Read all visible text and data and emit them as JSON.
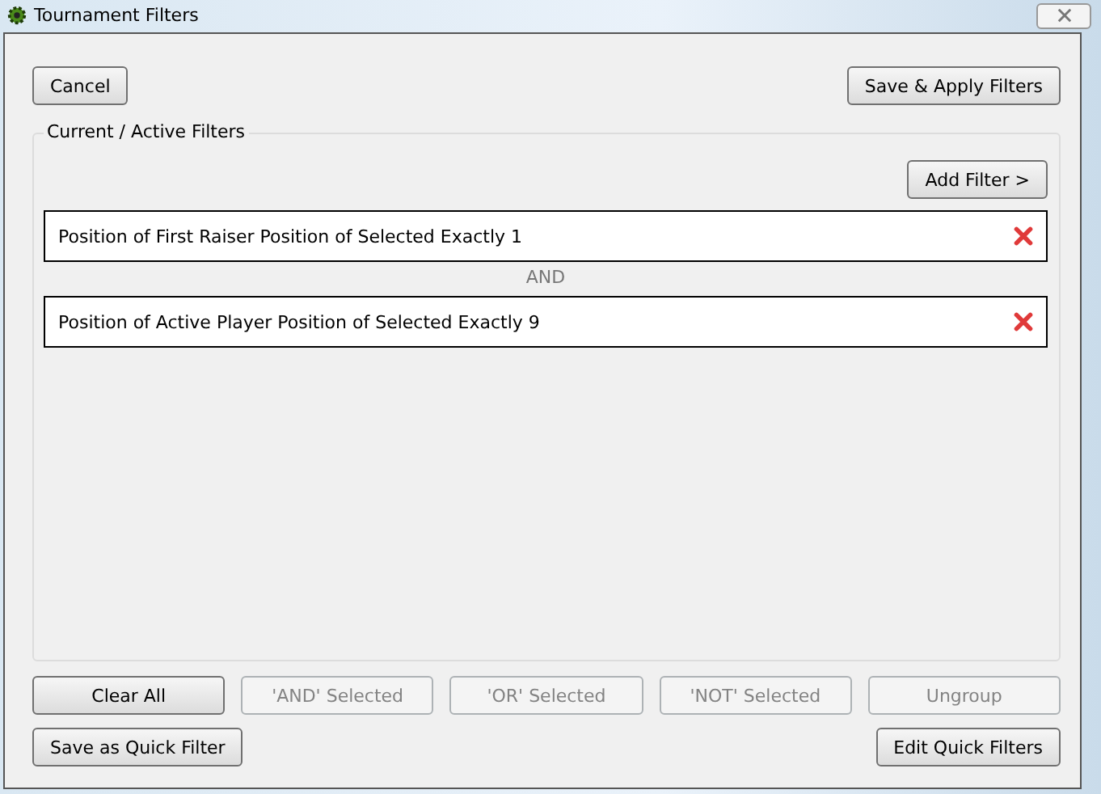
{
  "window": {
    "title": "Tournament Filters"
  },
  "top_buttons": [
    {
      "label": "Cancel",
      "disabled": false
    },
    {
      "label": "Save & Apply Filters",
      "disabled": false
    }
  ],
  "group": {
    "title": "Current / Active Filters",
    "add_button": "Add Filter >",
    "filters": [
      {
        "text": "Position of First Raiser Position of Selected Exactly 1"
      },
      {
        "text": "Position of Active Player Position of Selected Exactly 9"
      }
    ],
    "connectors": [
      "AND"
    ]
  },
  "action_buttons": [
    {
      "label": "Clear All",
      "disabled": false
    },
    {
      "label": "'AND' Selected",
      "disabled": true
    },
    {
      "label": "'OR' Selected",
      "disabled": true
    },
    {
      "label": "'NOT' Selected",
      "disabled": true
    },
    {
      "label": "Ungroup",
      "disabled": true
    }
  ],
  "quick_buttons": [
    {
      "label": "Save as Quick Filter",
      "disabled": false
    },
    {
      "label": "Edit Quick Filters",
      "disabled": false
    }
  ]
}
